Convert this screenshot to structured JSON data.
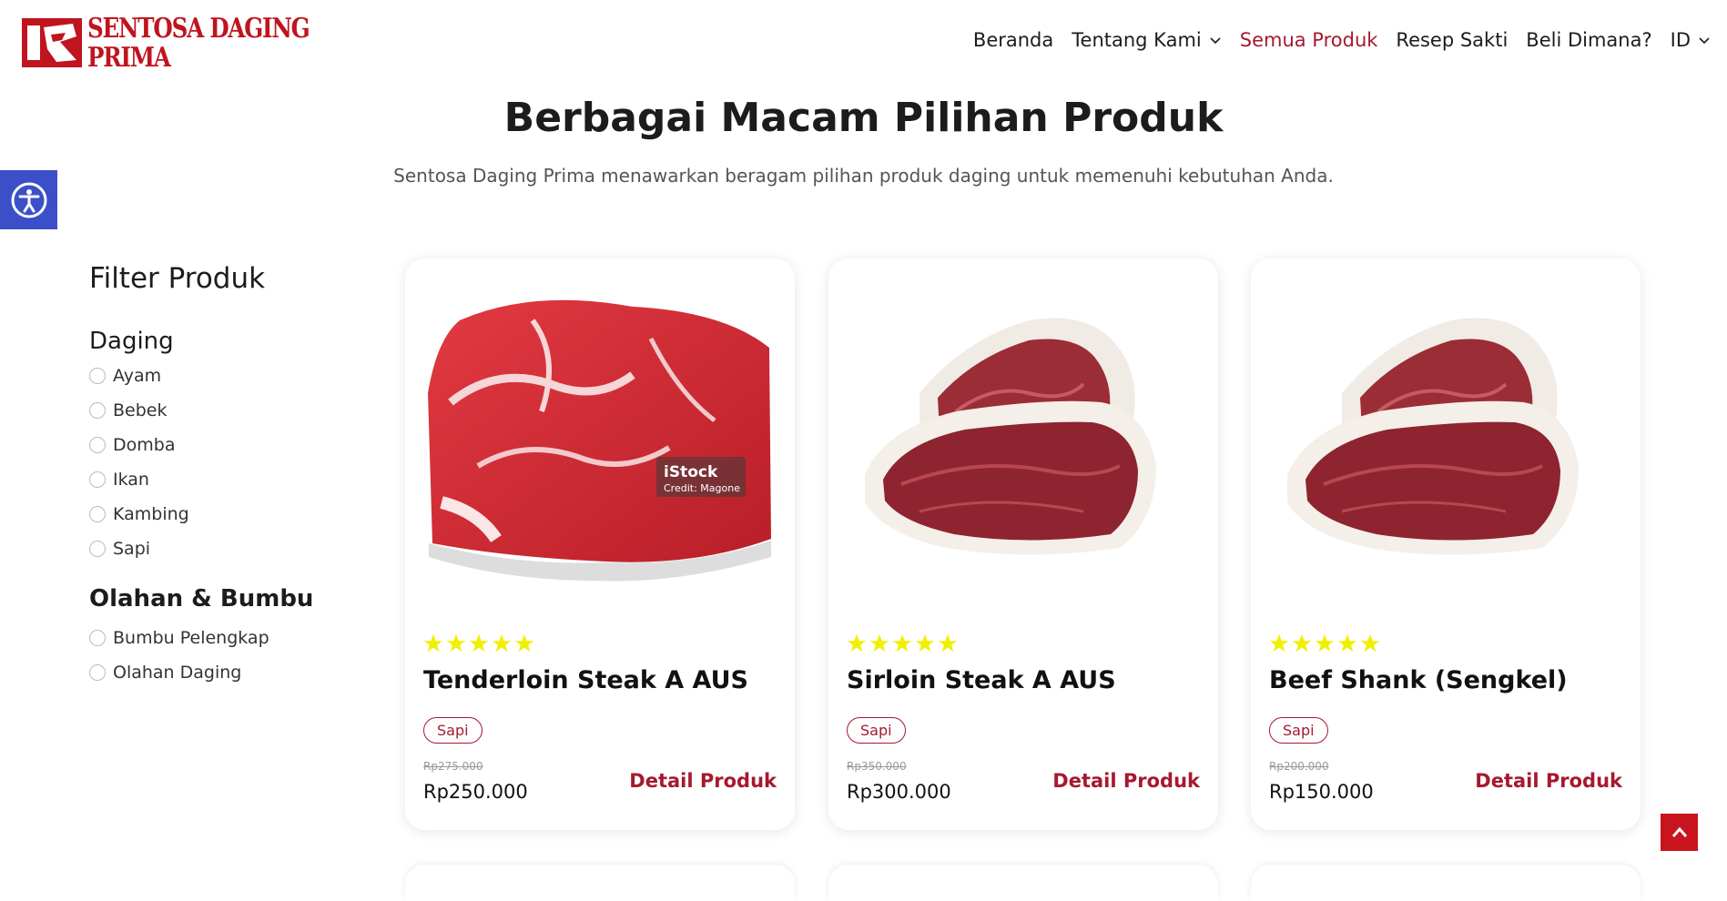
{
  "brand": {
    "line1": "SENTOSA DAGING",
    "line2": "PRIMA",
    "color": "#c0141e"
  },
  "nav": {
    "items": [
      {
        "label": "Beranda"
      },
      {
        "label": "Tentang Kami"
      },
      {
        "label": "Semua Produk"
      },
      {
        "label": "Resep Sakti"
      },
      {
        "label": "Beli Dimana?"
      },
      {
        "label": "ID"
      }
    ],
    "active_color": "#a6192e"
  },
  "accessibility": {
    "icon": "accessibility-icon",
    "color": "#3b50c8"
  },
  "page": {
    "title": "Berbagai Macam Pilihan Produk",
    "subtitle": "Sentosa Daging Prima menawarkan beragam pilihan produk daging untuk memenuhi kebutuhan Anda."
  },
  "filter": {
    "title": "Filter Produk",
    "groups": [
      {
        "title": "Daging",
        "options": [
          "Ayam",
          "Bebek",
          "Domba",
          "Ikan",
          "Kambing",
          "Sapi"
        ]
      },
      {
        "title": "Olahan & Bumbu",
        "options": [
          "Bumbu Pelengkap",
          "Olahan Daging"
        ]
      }
    ]
  },
  "products": [
    {
      "name": "Tenderloin Steak A AUS",
      "category": "Sapi",
      "old_price": "Rp275.000",
      "price": "Rp250.000",
      "rating": 5,
      "detail_label": "Detail Produk",
      "watermark": "iStock",
      "watermark_credit": "Credit: Magone"
    },
    {
      "name": "Sirloin Steak A AUS",
      "category": "Sapi",
      "old_price": "Rp350.000",
      "price": "Rp300.000",
      "rating": 5,
      "detail_label": "Detail Produk"
    },
    {
      "name": "Beef Shank (Sengkel)",
      "category": "Sapi",
      "old_price": "Rp200.000",
      "price": "Rp150.000",
      "rating": 5,
      "detail_label": "Detail Produk"
    }
  ],
  "colors": {
    "accent": "#a6192e",
    "star": "#f0f000",
    "scroll_top": "#c8141e"
  },
  "scroll_top": {
    "icon": "chevron-up-icon"
  }
}
